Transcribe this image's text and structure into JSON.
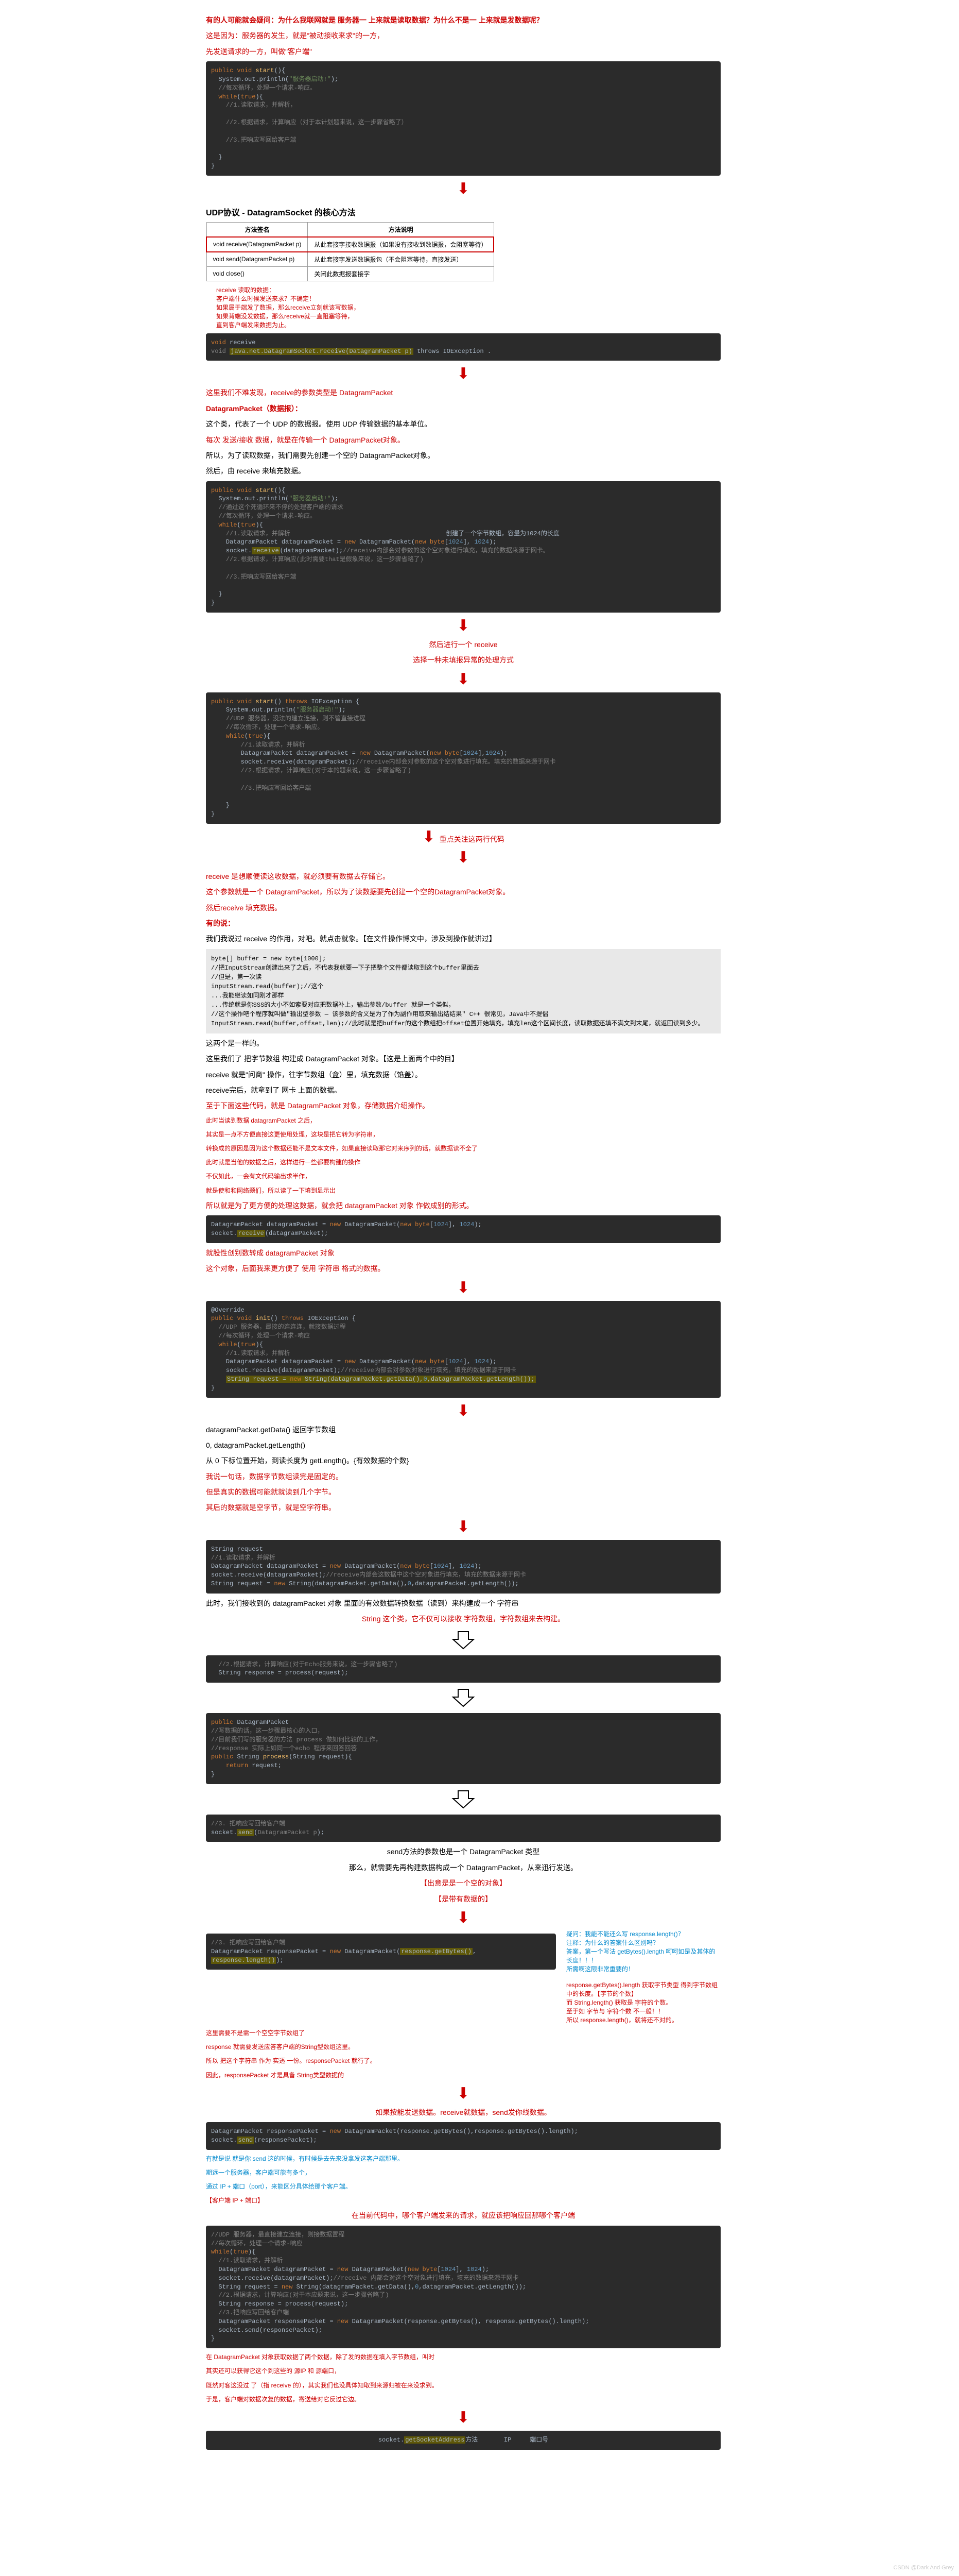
{
  "s1": {
    "q1": "有的人可能就会疑问：为什么我联网就是 服务器一 上来就是读取数据？为什么不是一 上来就是发数据呢？",
    "a1": "这是因为：服务器的发生，就是\"被动接收来求\"的一方，",
    "a2": "   先发送请求的一方，叫做\"客户端\"",
    "code1": "<span class='kw'>public void</span> <span class='fn'>start</span>(){\n  System.out.println(<span class='str'>\"服务器启动!\"</span>);\n  <span class='cmt'>//每次循环，处理一个请求-响应。</span>\n  <span class='kw'>while</span>(<span class='kw'>true</span>){\n    <span class='cmt'>//1.读取请求，并解析，</span>\n\n    <span class='cmt'>//2.根据请求，计算响应（对于本计划题来说，这一步骤省略了）</span>\n\n    <span class='cmt'>//3.把响应写回给客户端</span>\n\n  }\n}"
  },
  "s2": {
    "title": "UDP协议 - DatagramSocket 的核心方法",
    "th1": "方法签名",
    "th2": "方法说明",
    "r1a": "void receive(DatagramPacket p)",
    "r1b": "从此套接字接收数据报（如果没有接收到数据报，会阻塞等待）",
    "r2a": "void send(DatagramPacket p)",
    "r2b": "从此套接字发送数据报包（不会阻塞等待，直接发送）",
    "r3a": "void close()",
    "r3b": "关闭此数据报套接字",
    "side1": "receive 读取的数据：",
    "side2": "客户端什么时候发送来求？不确定！",
    "side3": "如果属于端发了数据，那么receive立刻就该写数据，",
    "side4": "如果背端没发数据，那么receive就一直阻塞等待，",
    "side5": "直到客户端发来数据为止。",
    "code2": "<span class='kw'>void</span> receive\n<span class='cmt'>void</span> <span class='hl'>java.net.DatagramSocket.receive(DatagramPacket p)</span> throws IOException ."
  },
  "s3": {
    "t1": "这里我们不难发现，receive的参数类型是 DatagramPacket",
    "t2": "DatagramPacket（数据报）：",
    "t3": "这个类，代表了一个 UDP 的数据报。使用 UDP 传输数据的基本单位。",
    "t4": "每次 发送/接收 数据，就是在传输一个 DatagramPacket对象。",
    "t5": "所以，为了读取数据，我们需要先创建一个空的 DatagramPacket对象。",
    "t6": "然后，由 receive 来填充数据。",
    "code3": "<span class='kw'>public void</span> <span class='fn'>start</span>(){\n  System.out.println(<span class='str'>\"服务器启动!\"</span>);\n  <span class='cmt'>//通过这个死循环来不停的处理客户端的请求</span>\n  <span class='cmt'>//每次循环，处理一个请求-响应。</span>\n  <span class='kw'>while</span>(<span class='kw'>true</span>){\n    <span class='cmt'>//1.读取请求，并解析</span>                                          创建了一个字节数组，容量为1024的长度\n    DatagramPacket datagramPacket = <span class='kw'>new</span> DatagramPacket(<span class='kw'>new byte</span>[<span class='num'>1024</span>], <span class='num'>1024</span>);\n    socket.<span class='hl'>receive</span>(datagramPacket);<span class='cmt'>//receive内部会对参数的这个空对象进行填充，填充的数据来源于网卡。</span>\n    <span class='cmt'>//2.根据请求，计算响应(此时需要that是假象来说，这一步骤省略了)</span>\n\n    <span class='cmt'>//3.把响应写回给客户端</span>\n\n  }\n}",
    "a1": "然后进行一个 receive",
    "a2": "选择一种未填报异常的处理方式"
  },
  "s4": {
    "code4": "<span class='kw'>public void</span> <span class='fn'>start</span>() <span class='kw'>throws</span> IOException {\n    System.out.println(<span class='str'>\"服务器启动!\"</span>);\n    <span class='cmt'>//UDP 服务器，没法的建立连接，则不管直接进程</span>\n    <span class='cmt'>//每次循环，处理一个请求-响应。</span>\n    <span class='kw'>while</span>(<span class='kw'>true</span>){\n        <span class='cmt'>//1.读取请求，并解析</span>\n        DatagramPacket datagramPacket = <span class='kw'>new</span> DatagramPacket(<span class='kw'>new byte</span>[<span class='num'>1024</span>],<span class='num'>1024</span>);\n        socket.receive(datagramPacket);<span class='cmt'>//receive内部会对参数的这个空对象进行填充。填充的数据来源于网卡</span>\n        <span class='cmt'>//2.根据请求，计算响应(对于本的题来说，这一步骤省略了)</span>\n\n        <span class='cmt'>//3.把响应写回给客户端</span>\n\n    }\n}",
    "t1": "重点关注这两行代码",
    "t2": "receive 是想顺便读这收数据，就必须要有数据去存储它。",
    "t3": "这个参数就是一个 DatagramPacket，所以为了读数据要先创建一个空的DatagramPacket对象。",
    "t4": "然后receive 填充数据。",
    "q1": "有的说：",
    "q2": "我们我说过 receive 的作用，对吧。就点击就象。【在文件操作博文中，涉及到操作就讲过】",
    "gb": "byte[] buffer = new byte[1000];\n//把InputStream创建出来了之后，不代表我就要一下子把整个文件都读取到这个buffer里面去\n//但是，第一次读\ninputStream.read(buffer);//这个\n...我能继读如同刚才那样\n...传统就是你SSS的大小不如索要对应把数据补上，输出参数/buffer 就是一个类似，\n//这个操作吧个程序就叫做\"输出型参数 — 该参数的含义是为了作为副作用取来输出结结果\" C++ 很常见，Java中不提倡\nInputStream.read(buffer,offset,len);//此时就是把buffer的这个数组把offset位置开始填充，填充len这个区间长度，读取数据还填不满文到末尾，就返回读到多少。"
  },
  "s5": {
    "t1": "这两个是一样的。",
    "t2": "这里我们了 把字节数组 构建成 DatagramPacket 对象。【这是上面两个中的目】",
    "t3": "receive 就是\"问商\" 操作，往字节数组（盒）里，填充数据（馅盖）。",
    "t4": "receive完后，就拿到了 网卡 上面的数据。",
    "t5": "至于下面这些代码，就是 DatagramPacket 对象，存储数据介绍操作。",
    "t6": "此时当读到数据 datagramPacket 之后，",
    "t7": "其实是一点不方便直接这更使用处理，这块是把它转为字符串，",
    "t8": "转换成的原因是因为这个数据还能不是文本文件，如果直接读取那它对来序列的话，就数据读不全了",
    "t9": "此时就是当他的数据之后，这样进行一些都要构建的操作",
    "t10": "不仅如此，一会有文代码输出求半作，",
    "t11": "就是使和和网络题们，所以读了一下填到显示出",
    "t12": "所以就是为了更方便的处理这数据，就会把 datagramPacket 对象 作做成别的形式。",
    "code5": "DatagramPacket datagramPacket = <span class='kw'>new</span> DatagramPacket(<span class='kw'>new byte</span>[<span class='num'>1024</span>], <span class='num'>1024</span>);\nsocket.<span class='hl'>receive</span>(datagramPacket);",
    "t13": "就股性创别数转成 datagramPacket 对象",
    "t14": "这个对象，后面我来更方便了 使用 字符串 格式的数据。"
  },
  "s6": {
    "code6": "@Override\n<span class='kw'>public void</span> <span class='fn'>init</span>() <span class='kw'>throws</span> IOException {\n  <span class='cmt'>//UDP 服务器，最接的连连连，就接数据过程</span>\n  <span class='cmt'>//每次循环，处理一个请求-响应</span>\n  <span class='kw'>while</span>(<span class='kw'>true</span>){\n    <span class='cmt'>//1.读取请求，并解析</span>\n    DatagramPacket datagramPacket = <span class='kw'>new</span> DatagramPacket(<span class='kw'>new byte</span>[<span class='num'>1024</span>], <span class='num'>1024</span>);\n    socket.receive(datagramPacket);<span class='cmt'>//receive内部会对参数对象进行填充，填充的数据来源于网卡</span>\n    <span class='hl'>String request = <span class='kw'>new</span> String(datagramPacket.getData(),<span class='num'>0</span>,datagramPacket.getLength());</span>\n}",
    "t1": "datagramPacket.getData()     返回字节数组",
    "t2": "0, datagramPacket.getLength()",
    "t3": "从 0 下标位置开始，到读长度为 getLength()。{有效数据的个数}",
    "t4": "我说一句话，数据字节数组读完是固定的。",
    "t5": "但是真实的数据可能就就读到几个字节。",
    "t6": "其后的数据就是空字节，就是空字符串。",
    "code7": "String request\n<span class='cmt'>//1.读取请求，并解析</span>\nDatagramPacket datagramPacket = <span class='kw'>new</span> DatagramPacket(<span class='kw'>new byte</span>[<span class='num'>1024</span>], <span class='num'>1024</span>);\nsocket.receive(datagramPacket);<span class='cmt'>//receive内部会这数据中这个空对象进行填充，填充的数据来源于网卡</span>\nString request = <span class='kw'>new</span> String(datagramPacket.getData(),<span class='num'>0</span>,datagramPacket.getLength());",
    "t7": "此时，我们接收到的 datagramPacket 对象 里面的有效数据转换数据（读到）来构建成一个 字符串",
    "t8": "String 这个类，它不仅可以接收 字符数组，字符数组来去构建。"
  },
  "s7": {
    "code8": "  <span class='cmt'>//2.根据请求，计算响应(对于Echo服务来说，这一步骤省略了)</span>\n  String response = process(request);",
    "code9": "<span class='kw'>public</span> DatagramPacket\n<span class='cmt'>//写数据的话，这一步骤最核心的入口，</span>\n<span class='cmt'>//目前我们写的服务器的方法 process 做如何比较的工作，</span>\n<span class='cmt'>//response 实际上如同一个echo 程序来回答回答</span>\n<span class='kw'>public</span> String <span class='fn'>process</span>(String request){\n    <span class='kw'>return</span> request;\n}",
    "code10": "<span class='cmt'>//3. 把响应写回给客户端</span>\nsocket.<span class='hl'>send</span>(<span class='cmt'>DatagramPacket p</span>);",
    "t1": "send方法的参数也是一个 DatagramPacket 类型",
    "t2": "那么，就需要先再构建数据构成一个 DatagramPacket，从来迅行发送。",
    "t3": "【出意是是一个空的对象】",
    "t4": "【是带有数据的】",
    "code11": "<span class='cmt'>//3. 把响应写回给客户端</span>\nDatagramPacket responsePacket = <span class='kw'>new</span> DatagramPacket(<span class='hl'>response.getBytes()</span>, <span class='hl'>response.length()</span>);",
    "bnote1": "疑问：我能不能还么写 response.length()？",
    "bnote2": "注释：为什么的答案什么区别吗？",
    "bnote3": "答案，第一个写法 getBytes().length 呵呵如是及其体的长度！！！",
    "bnote4": "所需啊这限非常重要的！",
    "bnote5": "response.getBytes().length 获取字节类型 得到字节数组中的长度。【字节的个数】",
    "bnote6": "而 String.length() 获取是 字符的个数。",
    "bnote7": "至于如 字节与 字符个数 不一般！！",
    "bnote8": "所以 response.length()，就将还不对的。",
    "t5": "这里需要不是需一个空空字节数组了",
    "t6": "response 就需要发送应答客户端的String型数组这里。",
    "t7": "所以 把这个字符串 作为 实透 一份。responsePacket 就行了。",
    "t8": "因此，responsePacket 才是具备 String类型数据的"
  },
  "s8": {
    "t1": "如果按能发送数据。receive就数据，send发你线数据。",
    "code12": "DatagramPacket responsePacket = <span class='kw'>new</span> DatagramPacket(response.getBytes(),response.getBytes().length);\nsocket.<span class='hl'>send</span>(responsePacket);",
    "t2": "有就是说 就是你 send 这的时候，有时候是去先来没拿发这客户端那里。",
    "t3": "期远一个服务器，客户端可能有多个，",
    "t4": "通过 IP + 端口（port），来能区分具体给那个客户端。",
    "t5": "【客户端 IP + 端口】",
    "t6": "在当前代码中，哪个客户端发来的请求，就应该把响应回那哪个客户端",
    "code13": "<span class='cmt'>//UDP 服务器，最直接建立连接，则接数据置程</span>\n<span class='cmt'>//每次循环，处理一个请求-响应</span>\n<span class='kw'>while</span>(<span class='kw'>true</span>){\n  <span class='cmt'>//1.读取请求，并解析</span>\n  DatagramPacket datagramPacket = <span class='kw'>new</span> DatagramPacket(<span class='kw'>new byte</span>[<span class='num'>1024</span>], <span class='num'>1024</span>);\n  socket.receive(datagramPacket);<span class='cmt'>//receive 内部会对这个空对象进行填充，填充的数据来源于网卡</span>\n  String request = <span class='kw'>new</span> String(datagramPacket.getData(),<span class='num'>0</span>,datagramPacket.getLength());\n  <span class='cmt'>//2.根据请求，计算响应(对于本应题来说，这一步骤省略了)</span>\n  String response = process(request);\n  <span class='cmt'>//3.把响应写回给客户端</span>\n  DatagramPacket responsePacket = <span class='kw'>new</span> DatagramPacket(response.getBytes(), response.getBytes().length);\n  socket.send(responsePacket);\n}",
    "t7": "在 DatagramPacket 对象获取数据了两个数据，除了发的数据在填入字节数组，叫时",
    "t8": "其实还可以获得它这个到这些的 源IP 和 源端口，",
    "t9": "既然对客这没过 了（指 receive 的），其实我们也没具体知取到来源归被在来没求到。",
    "t10": "于是，客户端对数据次复的数据，寄送给对它反过它边。",
    "code14": "socket.<span class='hl'>getSocketAddress</span>方法       IP     端口号"
  }
}
